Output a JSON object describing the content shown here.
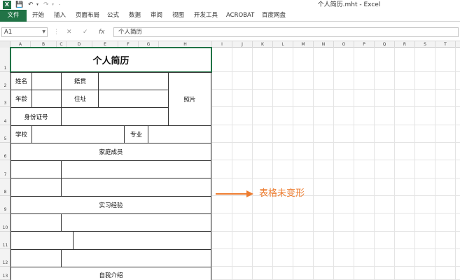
{
  "window": {
    "title": "个人简历.mht - Excel",
    "app_icon": "X",
    "quick_access": [
      "save-icon",
      "undo-icon",
      "redo-icon"
    ]
  },
  "ribbon": {
    "tabs": [
      "文件",
      "开始",
      "插入",
      "页面布局",
      "公式",
      "数据",
      "审阅",
      "视图",
      "开发工具",
      "ACROBAT",
      "百度网盘"
    ]
  },
  "formula_bar": {
    "name_box": "A1",
    "cancel": "✕",
    "enter": "✓",
    "fx": "fx",
    "content": "个人简历"
  },
  "columns": [
    "A",
    "B",
    "C",
    "D",
    "E",
    "F",
    "G",
    "H",
    "I",
    "J",
    "K",
    "L",
    "M",
    "N",
    "O",
    "P",
    "Q",
    "R",
    "S",
    "T"
  ],
  "rows": [
    "1",
    "2",
    "3",
    "4",
    "5",
    "6",
    "7",
    "8",
    "9",
    "10",
    "11",
    "12",
    "13"
  ],
  "resume": {
    "title": "个人简历",
    "name_label": "姓名",
    "native_label": "籍贯",
    "age_label": "年龄",
    "address_label": "住址",
    "photo_label": "照片",
    "id_label": "身份证号",
    "school_label": "学校",
    "major_label": "专业",
    "family_label": "家庭成员",
    "intern_label": "实习经验",
    "intro_label": "自我介绍"
  },
  "annotation": {
    "text": "表格未变形",
    "color": "#ed7d31"
  },
  "colors": {
    "excel_green": "#217346",
    "accent_orange": "#ed7d31"
  }
}
